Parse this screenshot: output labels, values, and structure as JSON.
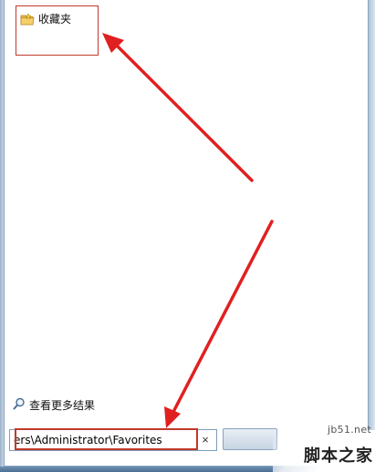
{
  "start_menu": {
    "results": [
      {
        "label": "收藏夹",
        "icon": "favorites-folder-icon"
      }
    ],
    "see_more_results": "查看更多结果",
    "search": {
      "value": "ers\\Administrator\\Favorites",
      "clear_label": "×"
    }
  },
  "colors": {
    "annotation": "#c0392b",
    "arrow": "#e02020"
  },
  "watermark": {
    "url": "jb51.net",
    "name": "脚本之家"
  }
}
